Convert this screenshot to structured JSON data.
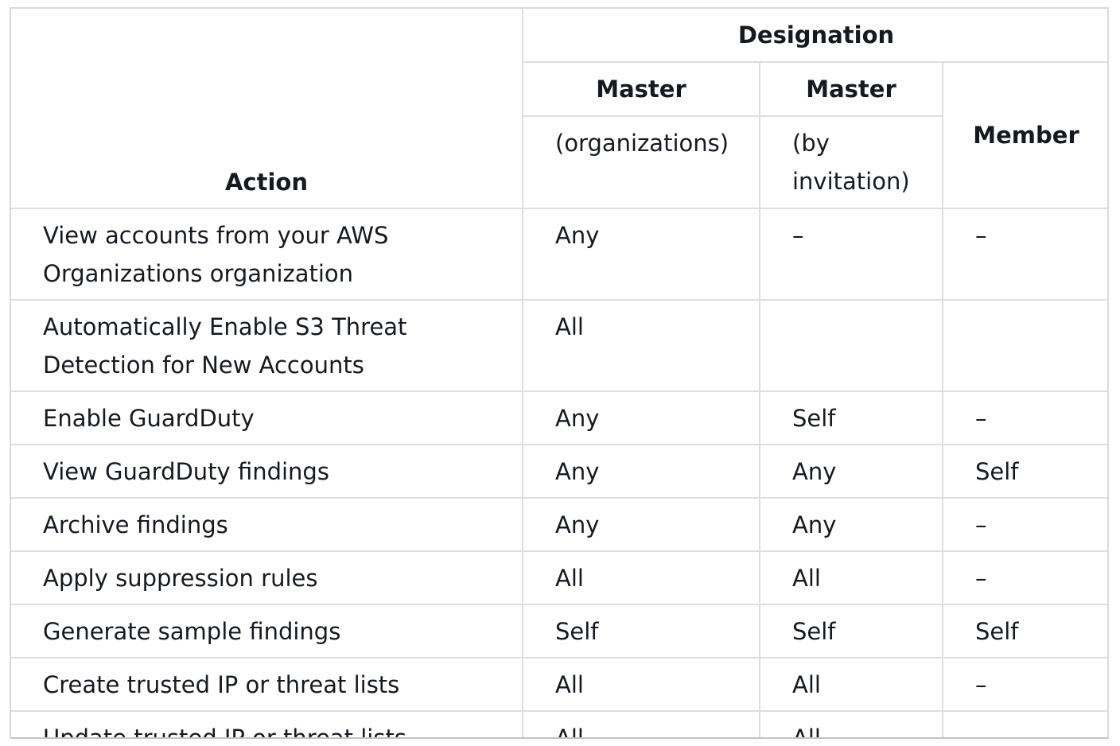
{
  "table": {
    "headers": {
      "action": "Action",
      "designation": "Designation",
      "master_org": "Master",
      "master_org_sub": "(organizations)",
      "master_inv": "Master",
      "master_inv_sub": "(by invitation)",
      "member": "Member"
    },
    "rows": [
      {
        "action": "View accounts from your AWS Organizations organization",
        "org": "Any",
        "inv": "–",
        "member": "–"
      },
      {
        "action": "Automatically Enable S3 Threat Detection for New Accounts",
        "org": "All",
        "inv": "",
        "member": ""
      },
      {
        "action": "Enable GuardDuty",
        "org": "Any",
        "inv": "Self",
        "member": "–"
      },
      {
        "action": "View GuardDuty findings",
        "org": "Any",
        "inv": "Any",
        "member": "Self"
      },
      {
        "action": "Archive findings",
        "org": "Any",
        "inv": "Any",
        "member": "–"
      },
      {
        "action": "Apply suppression rules",
        "org": "All",
        "inv": "All",
        "member": "–"
      },
      {
        "action": "Generate sample findings",
        "org": "Self",
        "inv": "Self",
        "member": "Self"
      },
      {
        "action": "Create trusted IP or threat lists",
        "org": "All",
        "inv": "All",
        "member": "–"
      },
      {
        "action": "Update trusted IP or threat lists",
        "org": "All",
        "inv": "All",
        "member": "–"
      }
    ]
  },
  "colors": {
    "text": "#16191f",
    "border": "#dcdfe0"
  }
}
